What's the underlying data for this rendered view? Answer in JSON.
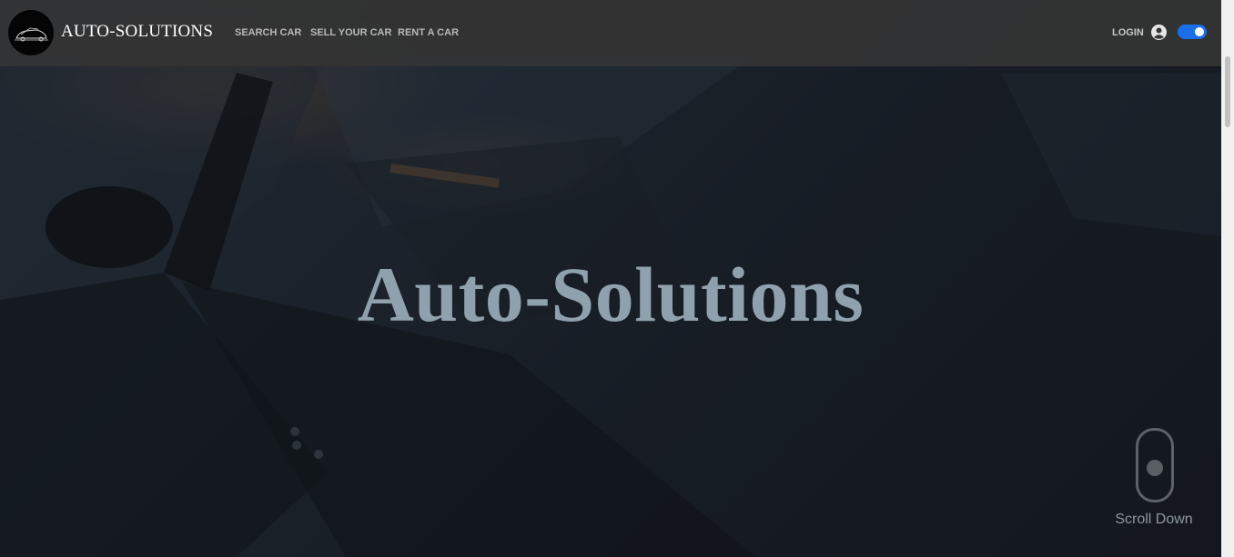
{
  "header": {
    "brand": "AUTO-SOLUTIONS",
    "nav": [
      {
        "label": "SEARCH CAR"
      },
      {
        "label": "SELL YOUR CAR"
      },
      {
        "label": "RENT A CAR"
      }
    ],
    "login_label": "LOGIN",
    "user_icon": "user-circle-icon",
    "theme_toggle": {
      "state": "on",
      "color": "#1a6fe8"
    }
  },
  "hero": {
    "title": "Auto-Solutions",
    "scroll_label": "Scroll Down",
    "scroll_icon": "mouse-scroll-icon"
  },
  "colors": {
    "header_bg": "#343434",
    "title": "#8fa1ad",
    "accent": "#1a6fe8"
  }
}
